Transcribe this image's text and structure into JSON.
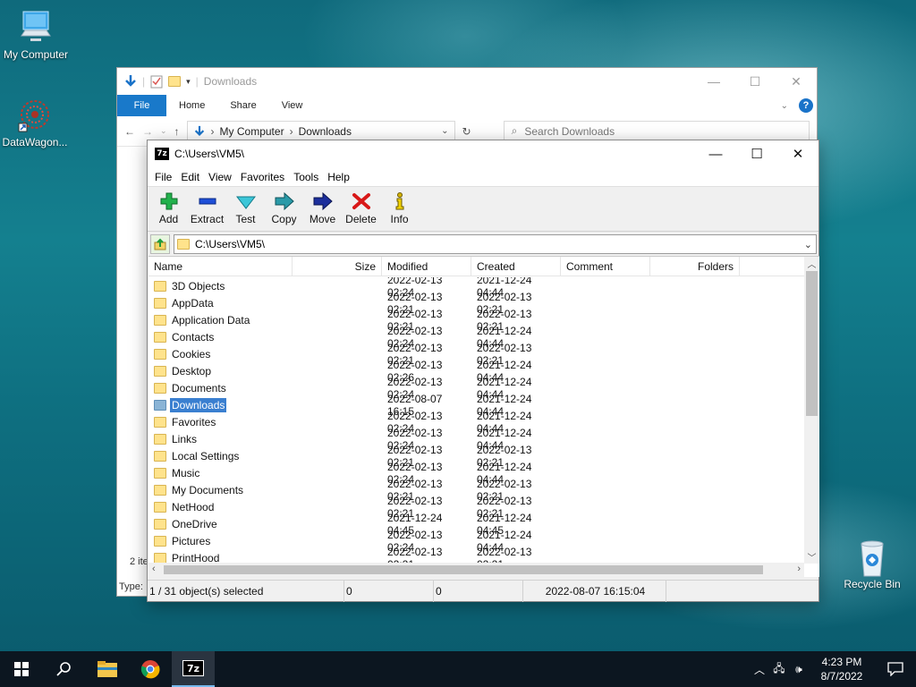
{
  "desktop": {
    "icons": [
      {
        "label": "My Computer"
      },
      {
        "label": "DataWagon..."
      },
      {
        "label": "Recycle Bin"
      }
    ]
  },
  "explorer": {
    "title": "Downloads",
    "tabs": [
      "File",
      "Home",
      "Share",
      "View"
    ],
    "breadcrumb": [
      "My Computer",
      "Downloads"
    ],
    "search_placeholder": "Search Downloads",
    "status_partial": "2 ite",
    "type_partial": "Type:"
  },
  "zip": {
    "title": "C:\\Users\\VM5\\",
    "menu": [
      "File",
      "Edit",
      "View",
      "Favorites",
      "Tools",
      "Help"
    ],
    "toolbar": [
      "Add",
      "Extract",
      "Test",
      "Copy",
      "Move",
      "Delete",
      "Info"
    ],
    "path": "C:\\Users\\VM5\\",
    "columns": [
      "Name",
      "Size",
      "Modified",
      "Created",
      "Comment",
      "Folders"
    ],
    "rows": [
      {
        "name": "3D Objects",
        "modified": "2022-02-13 02:24",
        "created": "2021-12-24 04:44"
      },
      {
        "name": "AppData",
        "modified": "2022-02-13 02:21",
        "created": "2022-02-13 02:21"
      },
      {
        "name": "Application Data",
        "modified": "2022-02-13 02:21",
        "created": "2022-02-13 02:21"
      },
      {
        "name": "Contacts",
        "modified": "2022-02-13 02:24",
        "created": "2021-12-24 04:44"
      },
      {
        "name": "Cookies",
        "modified": "2022-02-13 02:21",
        "created": "2022-02-13 02:21"
      },
      {
        "name": "Desktop",
        "modified": "2022-02-13 02:26",
        "created": "2021-12-24 04:44"
      },
      {
        "name": "Documents",
        "modified": "2022-02-13 02:24",
        "created": "2021-12-24 04:44"
      },
      {
        "name": "Downloads",
        "modified": "2022-08-07 16:15",
        "created": "2021-12-24 04:44",
        "selected": true
      },
      {
        "name": "Favorites",
        "modified": "2022-02-13 02:24",
        "created": "2021-12-24 04:44"
      },
      {
        "name": "Links",
        "modified": "2022-02-13 02:24",
        "created": "2021-12-24 04:44"
      },
      {
        "name": "Local Settings",
        "modified": "2022-02-13 02:21",
        "created": "2022-02-13 02:21"
      },
      {
        "name": "Music",
        "modified": "2022-02-13 02:24",
        "created": "2021-12-24 04:44"
      },
      {
        "name": "My Documents",
        "modified": "2022-02-13 02:21",
        "created": "2022-02-13 02:21"
      },
      {
        "name": "NetHood",
        "modified": "2022-02-13 02:21",
        "created": "2022-02-13 02:21"
      },
      {
        "name": "OneDrive",
        "modified": "2021-12-24 04:45",
        "created": "2021-12-24 04:45"
      },
      {
        "name": "Pictures",
        "modified": "2022-02-13 02:24",
        "created": "2021-12-24 04:44"
      },
      {
        "name": "PrintHood",
        "modified": "2022-02-13 02:21",
        "created": "2022-02-13 02:21"
      }
    ],
    "status": {
      "selection": "1 / 31 object(s) selected",
      "size": "0",
      "packed": "0",
      "date": "2022-08-07 16:15:04"
    }
  },
  "taskbar": {
    "time": "4:23 PM",
    "date": "8/7/2022",
    "app_badge": "7z"
  }
}
